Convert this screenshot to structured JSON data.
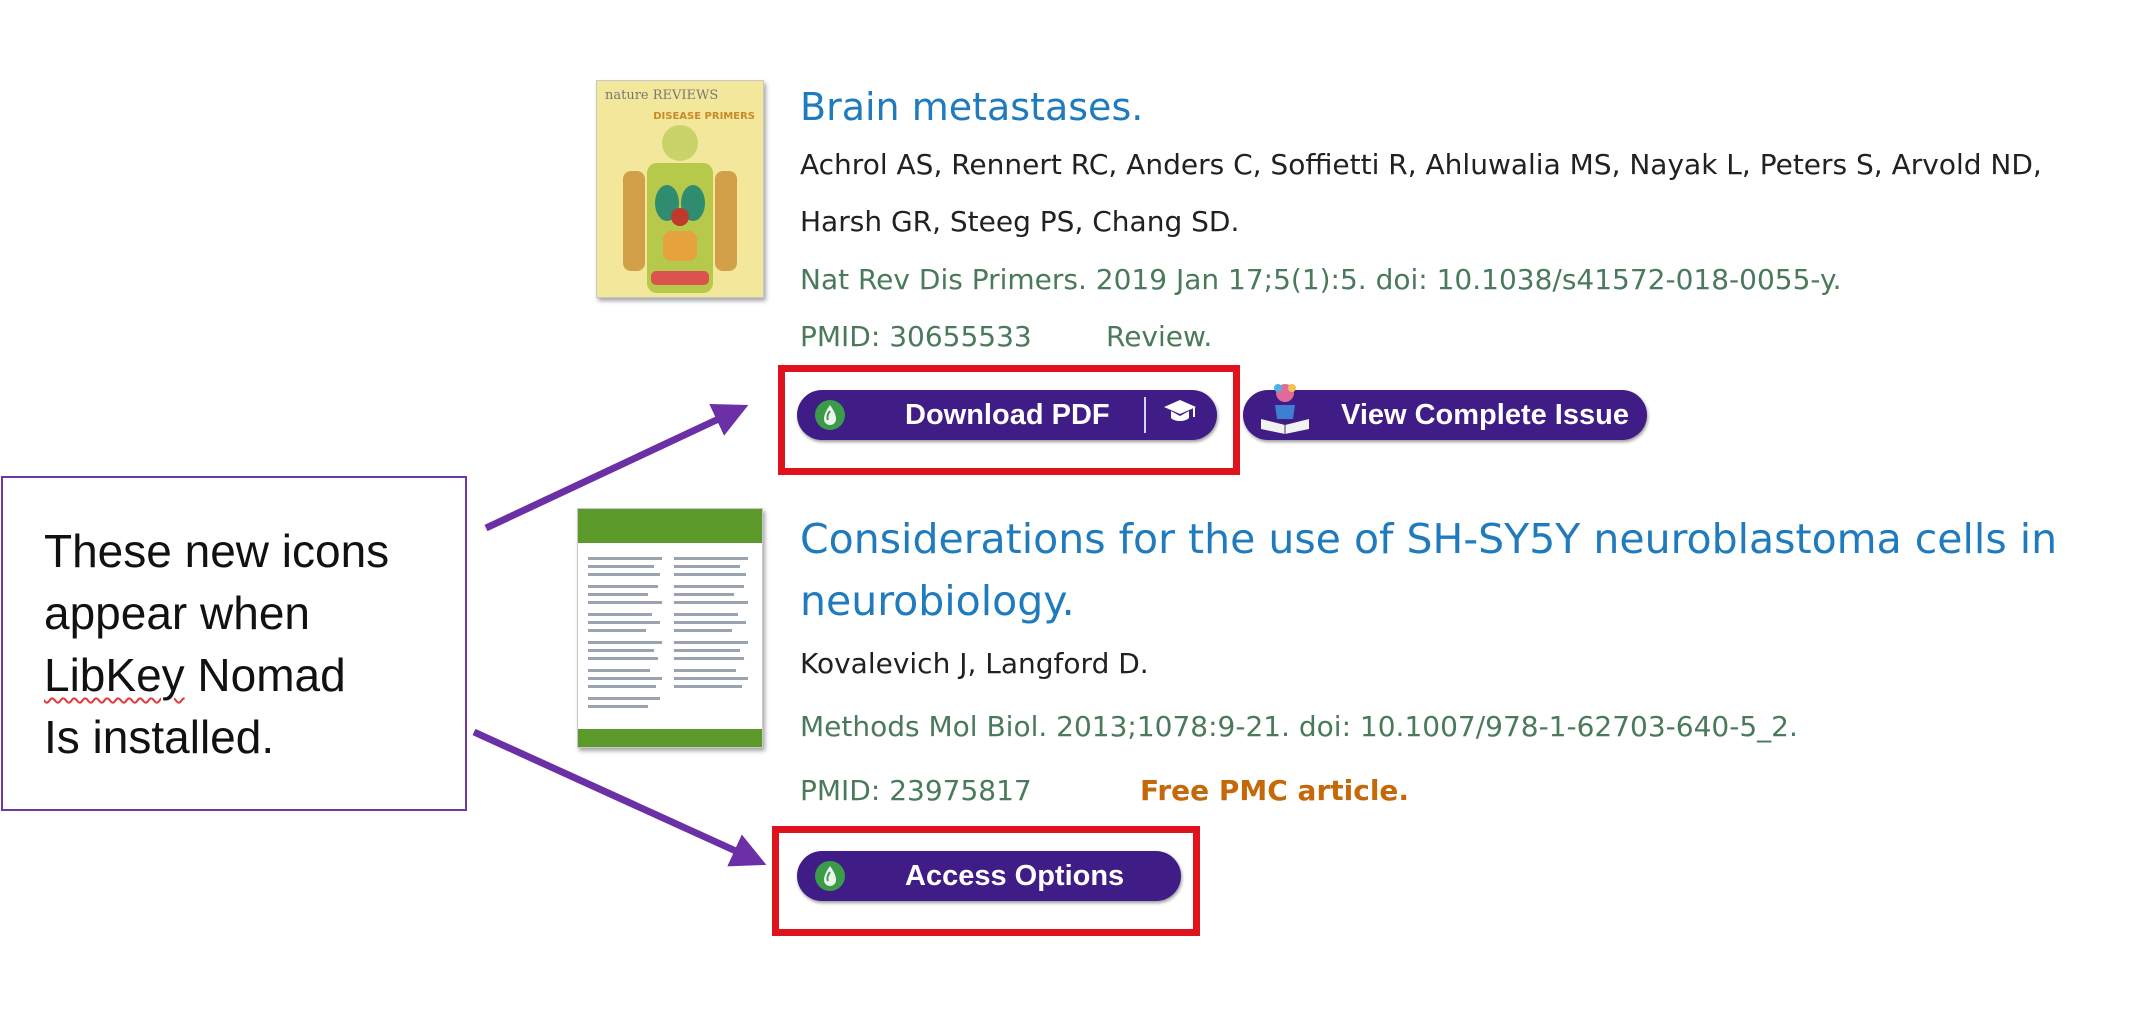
{
  "articles": [
    {
      "title": "Brain metastases.",
      "authors_line1": "Achrol AS, Rennert RC, Anders C, Soffietti R, Ahluwalia MS, Nayak L, Peters S, Arvold ND,",
      "authors_line2": "Harsh GR, Steeg PS, Chang SD.",
      "citation": "Nat Rev Dis Primers. 2019 Jan 17;5(1):5. doi: 10.1038/s41572-018-0055-y.",
      "pmid": "PMID: 30655533",
      "type": "Review.",
      "thumbnail": {
        "brand": "nature REVIEWS",
        "label": "DISEASE PRIMERS"
      },
      "buttons": {
        "primary": "Download PDF",
        "secondary": "View Complete Issue"
      }
    },
    {
      "title": "Considerations for the use of SH-SY5Y neuroblastoma cells in neurobiology.",
      "authors": "Kovalevich J, Langford D.",
      "citation": "Methods Mol Biol. 2013;1078:9-21. doi: 10.1007/978-1-62703-640-5_2.",
      "pmid": "PMID: 23975817",
      "free_label": "Free PMC article.",
      "buttons": {
        "primary": "Access Options"
      }
    }
  ],
  "callout": {
    "line1": "These new icons",
    "line2": "appear when",
    "line3_word": "LibKey",
    "line3_rest": " Nomad",
    "line4": "Is installed."
  },
  "icons": [
    "libkey-drop-icon",
    "graduation-cap-icon",
    "book-reader-icon"
  ],
  "colors": {
    "title_link": "#1f7bbd",
    "citation": "#4a7a5a",
    "free_pmc": "#c4680a",
    "libkey_button": "#3f1c86",
    "highlight_box": "#e0131d",
    "callout_border": "#6a3aa0",
    "arrow": "#6b2fa6"
  }
}
